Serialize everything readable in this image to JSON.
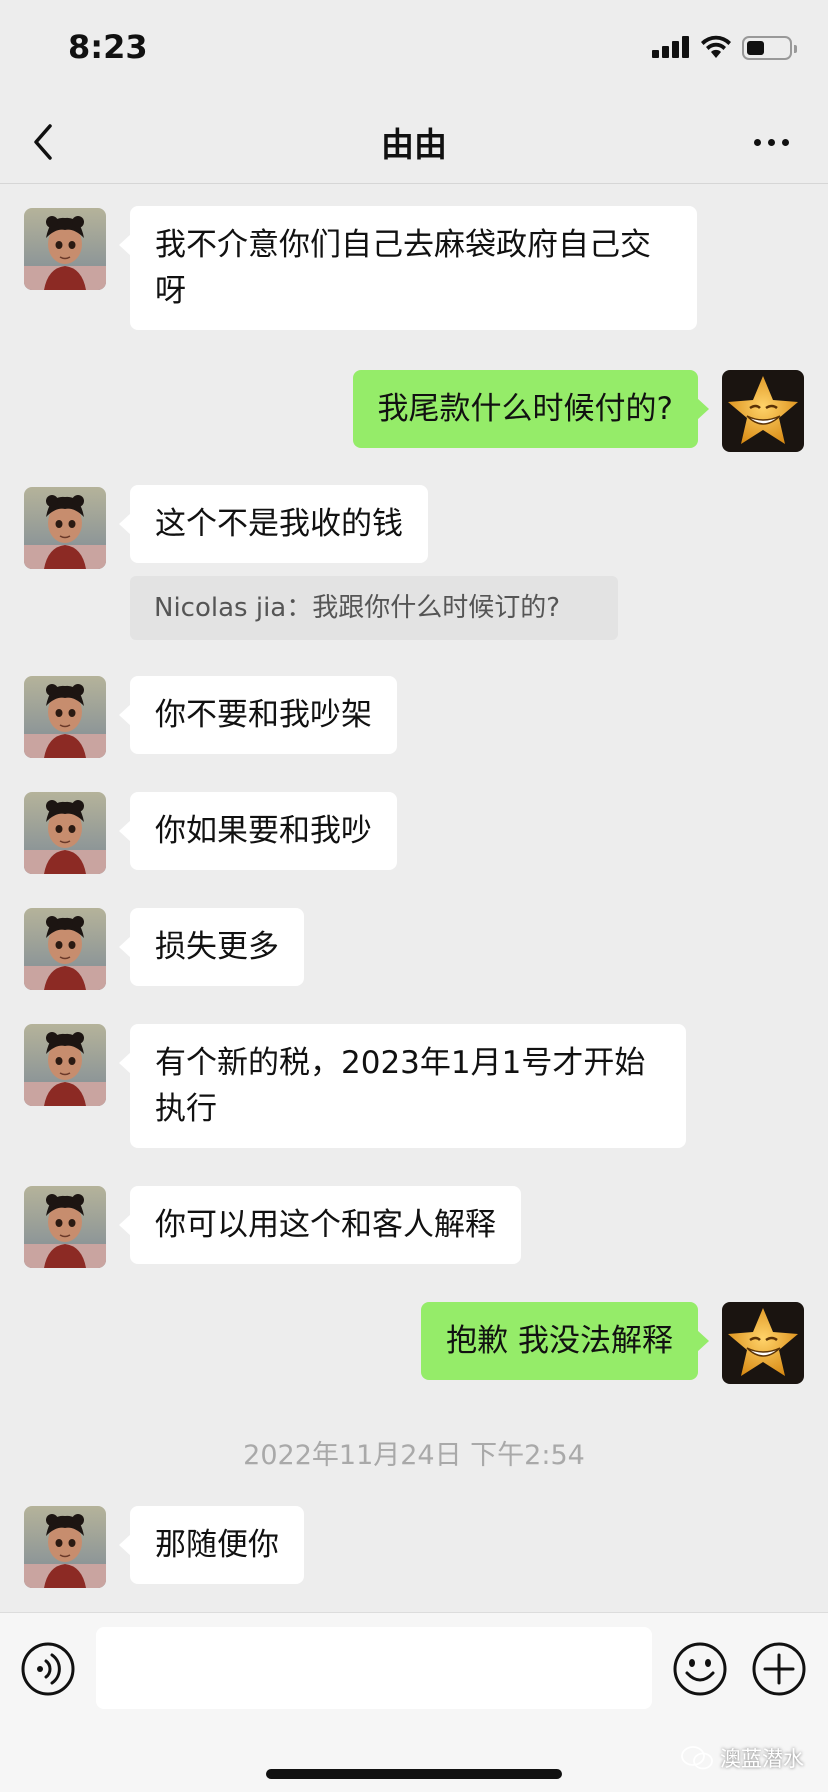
{
  "status_bar": {
    "time": "8:23",
    "icons": [
      "signal-icon",
      "wifi-icon",
      "battery-icon"
    ]
  },
  "header": {
    "title": "由由",
    "icons": [
      "back-icon",
      "more-icon"
    ]
  },
  "messages": [
    {
      "side": "in",
      "text": "我不介意你们自己去麻袋政府自己交呀"
    },
    {
      "side": "out",
      "text": "我尾款什么时候付的?"
    },
    {
      "side": "in",
      "text": "这个不是我收的钱",
      "quote": "Nicolas jia：我跟你什么时候订的?"
    },
    {
      "side": "in",
      "text": "你不要和我吵架"
    },
    {
      "side": "in",
      "text": "你如果要和我吵"
    },
    {
      "side": "in",
      "text": "损失更多"
    },
    {
      "side": "in",
      "text": "有个新的税，2023年1月1号才开始执行"
    },
    {
      "side": "in",
      "text": "你可以用这个和客人解释"
    },
    {
      "side": "out",
      "text": "抱歉 我没法解释"
    },
    {
      "side": "timestamp",
      "text": "2022年11月24日 下午2:54"
    },
    {
      "side": "in",
      "text": "那随便你"
    }
  ],
  "input_bar": {
    "value": "",
    "icons": [
      "voice-icon",
      "emoji-icon",
      "plus-icon"
    ]
  },
  "watermark": "澳蓝潜水",
  "colors": {
    "background": "#ededed",
    "sent_bubble": "#95ec69",
    "received_bubble": "#ffffff"
  }
}
